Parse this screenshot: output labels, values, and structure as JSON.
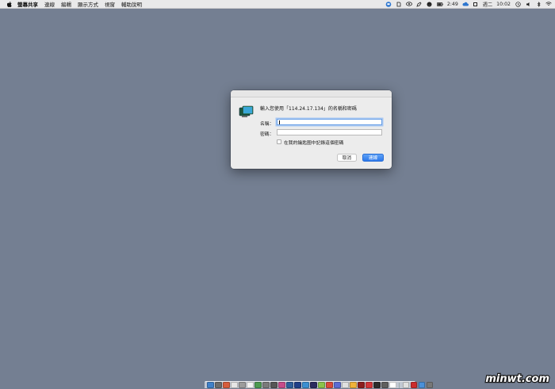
{
  "menubar": {
    "app_name": "螢幕共享",
    "menus": [
      "連線",
      "編輯",
      "顯示方式",
      "視窗",
      "輔助說明"
    ],
    "status": {
      "clock_text": "2:49",
      "day": "週二",
      "time": "10:02"
    }
  },
  "dialog": {
    "prompt": "輸入您使用「114.24.17.134」的名稱和密碼",
    "name_label": "名稱：",
    "name_value": "",
    "password_label": "密碼：",
    "password_value": "",
    "remember_label": "在我的鑰匙圈中記錄這個密碼",
    "remember_checked": false,
    "cancel_label": "取消",
    "ok_label": "連線"
  },
  "dock": {
    "icon_colors": [
      "#3f80c9",
      "#6b6b6b",
      "#d65c3c",
      "#e6e6e6",
      "#9c9c9c",
      "#f2f2f2",
      "#4c9a50",
      "#7a7a7a",
      "#565656",
      "#c74b8a",
      "#2e5f9c",
      "#1f3f88",
      "#3b8fd1",
      "#2a2a5e",
      "#8bc34a",
      "#d94a3a",
      "#5b6bd3",
      "#e0e0e0",
      "#f0b23a",
      "#8c1e1e",
      "#d13438",
      "#2b2b2b",
      "#5f5f5f",
      "#ffffff",
      "#e0e0e0",
      "#cc2b2b",
      "#4a90d9",
      "#777777"
    ]
  },
  "watermark": {
    "text": "minwt.com"
  }
}
